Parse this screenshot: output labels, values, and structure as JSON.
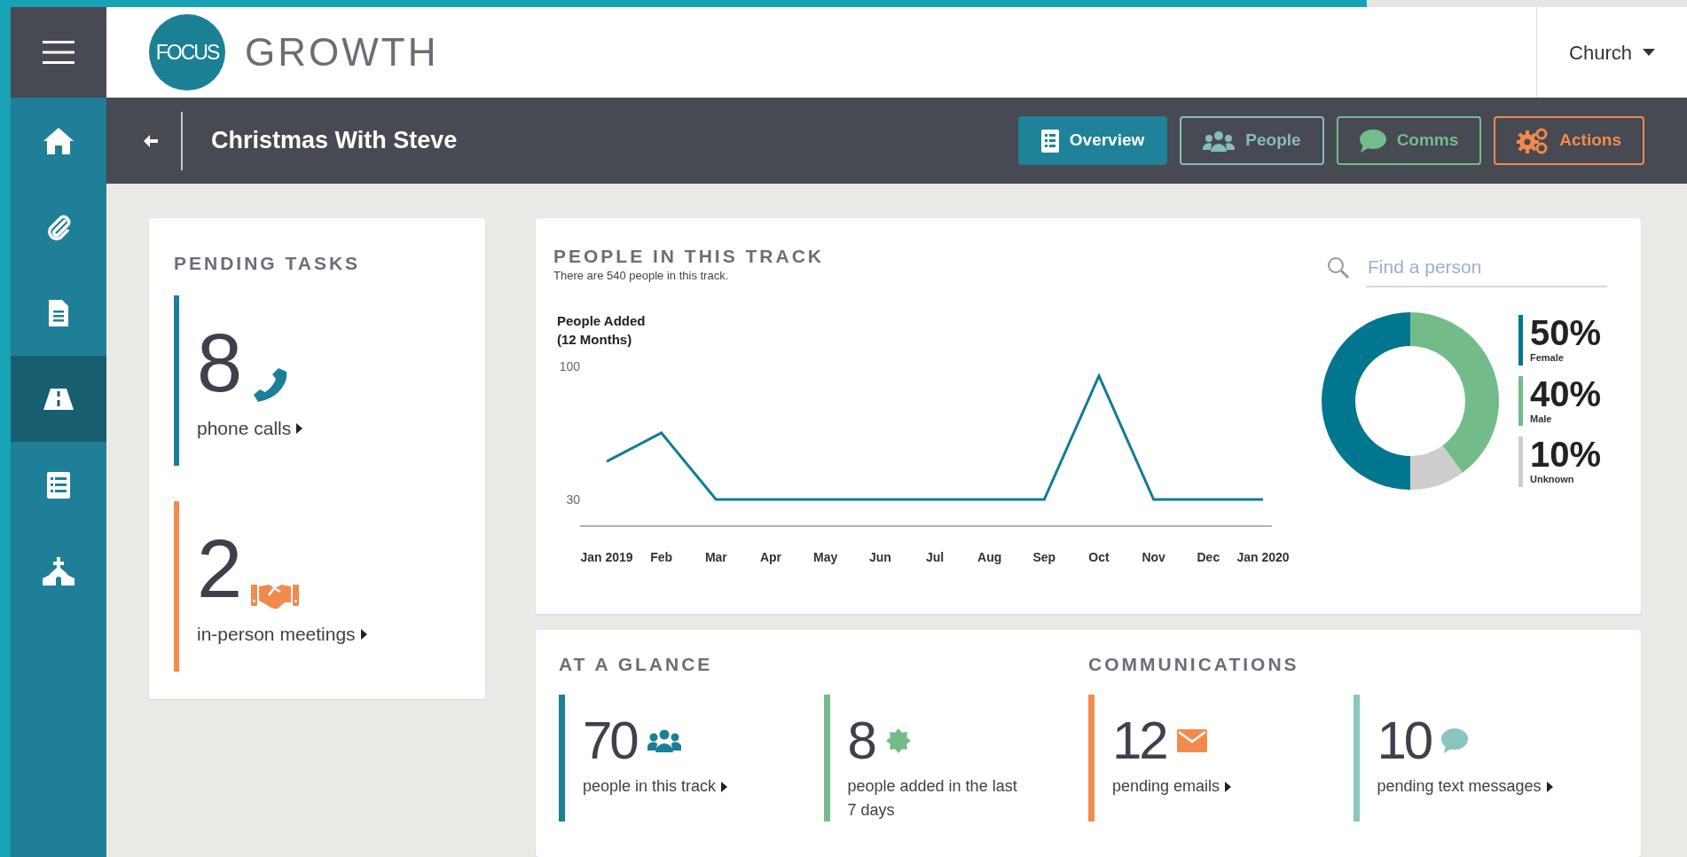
{
  "logo": {
    "badge": "FOCUS",
    "word": "GROWTH"
  },
  "account_menu": {
    "label": "Church"
  },
  "sidebar": {
    "items": [
      {
        "kind": "home",
        "selected": false
      },
      {
        "kind": "attachments",
        "selected": false
      },
      {
        "kind": "document",
        "selected": false
      },
      {
        "kind": "road",
        "selected": true
      },
      {
        "kind": "list",
        "selected": false
      },
      {
        "kind": "church",
        "selected": false
      }
    ]
  },
  "page": {
    "title": "Christmas With Steve"
  },
  "tabs": [
    {
      "label": "Overview",
      "kind": "overview",
      "color": "#1f8299",
      "selected": true
    },
    {
      "label": "People",
      "kind": "people",
      "color": "#86bdbb",
      "selected": false
    },
    {
      "label": "Comms",
      "kind": "comms",
      "color": "#72bd8a",
      "selected": false
    },
    {
      "label": "Actions",
      "kind": "actions",
      "color": "#f28a4e",
      "selected": false
    }
  ],
  "pending_tasks": {
    "title": "PENDING TASKS",
    "items": [
      {
        "count": "8",
        "label": "phone calls",
        "kind": "phone",
        "color": "#1a7f97",
        "linked": true
      },
      {
        "count": "2",
        "label": "in-person meetings",
        "kind": "meeting",
        "color": "#f28a4e",
        "linked": true
      }
    ]
  },
  "people_track": {
    "title": "PEOPLE IN THIS TRACK",
    "subtitle": "There are 540 people in this track.",
    "search": {
      "placeholder": "Find a person"
    },
    "chart_data": {
      "type": "line",
      "title": "People Added (12 Months)",
      "categories": [
        "Jan 2019",
        "Feb",
        "Mar",
        "Apr",
        "May",
        "Jun",
        "Jul",
        "Aug",
        "Sep",
        "Oct",
        "Nov",
        "Dec",
        "Jan 2020"
      ],
      "series": [
        {
          "color": "#127c93",
          "values": [
            50,
            65,
            30,
            30,
            30,
            30,
            30,
            30,
            30,
            95,
            30,
            30,
            30
          ]
        }
      ],
      "ylim": [
        30,
        100
      ],
      "yticks": [
        30,
        100
      ]
    },
    "gender": {
      "chart_data": {
        "type": "donut",
        "categories": [
          "Female",
          "Male",
          "Unknown"
        ],
        "values": [
          50,
          40,
          10
        ]
      },
      "legend": [
        {
          "percent": "50%",
          "color": "#00768f"
        },
        {
          "percent": "40%",
          "color": "#74bb8a"
        },
        {
          "percent": "10%",
          "color": "#cdcdcd"
        }
      ]
    }
  },
  "at_a_glance": {
    "title": "AT A GLANCE",
    "items": [
      {
        "count": "70",
        "label": "people in this track",
        "kind": "people",
        "color": "#1a7f97",
        "linked": true
      },
      {
        "count": "8",
        "label": "people added in the last 7 days",
        "kind": "new",
        "color": "#74bb8a",
        "linked": false
      }
    ]
  },
  "communications": {
    "title": "COMMUNICATIONS",
    "items": [
      {
        "count": "12",
        "label": "pending emails",
        "kind": "email",
        "color": "#f28a4e",
        "linked": true
      },
      {
        "count": "10",
        "label": "pending text messages",
        "kind": "sms",
        "color": "#8cc4bf",
        "linked": true
      }
    ]
  }
}
